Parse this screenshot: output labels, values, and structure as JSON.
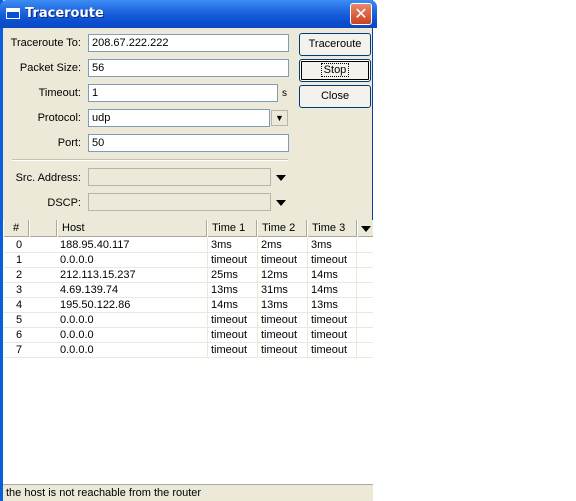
{
  "window": {
    "title": "Traceroute",
    "close_glyph": "✕"
  },
  "form": {
    "traceroute_to": {
      "label": "Traceroute To:",
      "value": "208.67.222.222"
    },
    "packet_size": {
      "label": "Packet Size:",
      "value": "56"
    },
    "timeout": {
      "label": "Timeout:",
      "value": "1",
      "unit": "s"
    },
    "protocol": {
      "label": "Protocol:",
      "value": "udp"
    },
    "port": {
      "label": "Port:",
      "value": "50"
    },
    "src_address": {
      "label": "Src. Address:",
      "value": ""
    },
    "dscp": {
      "label": "DSCP:",
      "value": ""
    }
  },
  "buttons": {
    "traceroute": "Traceroute",
    "stop": "Stop",
    "close": "Close"
  },
  "table": {
    "columns": [
      "#",
      "",
      "Host",
      "Time 1",
      "Time 2",
      "Time 3"
    ],
    "rows": [
      {
        "hop": "0",
        "host": "188.95.40.117",
        "t1": "3ms",
        "t2": "2ms",
        "t3": "3ms"
      },
      {
        "hop": "1",
        "host": "0.0.0.0",
        "t1": "timeout",
        "t2": "timeout",
        "t3": "timeout"
      },
      {
        "hop": "2",
        "host": "212.113.15.237",
        "t1": "25ms",
        "t2": "12ms",
        "t3": "14ms"
      },
      {
        "hop": "3",
        "host": "4.69.139.74",
        "t1": "13ms",
        "t2": "31ms",
        "t3": "14ms"
      },
      {
        "hop": "4",
        "host": "195.50.122.86",
        "t1": "14ms",
        "t2": "13ms",
        "t3": "13ms"
      },
      {
        "hop": "5",
        "host": "0.0.0.0",
        "t1": "timeout",
        "t2": "timeout",
        "t3": "timeout"
      },
      {
        "hop": "6",
        "host": "0.0.0.0",
        "t1": "timeout",
        "t2": "timeout",
        "t3": "timeout"
      },
      {
        "hop": "7",
        "host": "0.0.0.0",
        "t1": "timeout",
        "t2": "timeout",
        "t3": "timeout"
      }
    ]
  },
  "status": "the host is not reachable from the router"
}
